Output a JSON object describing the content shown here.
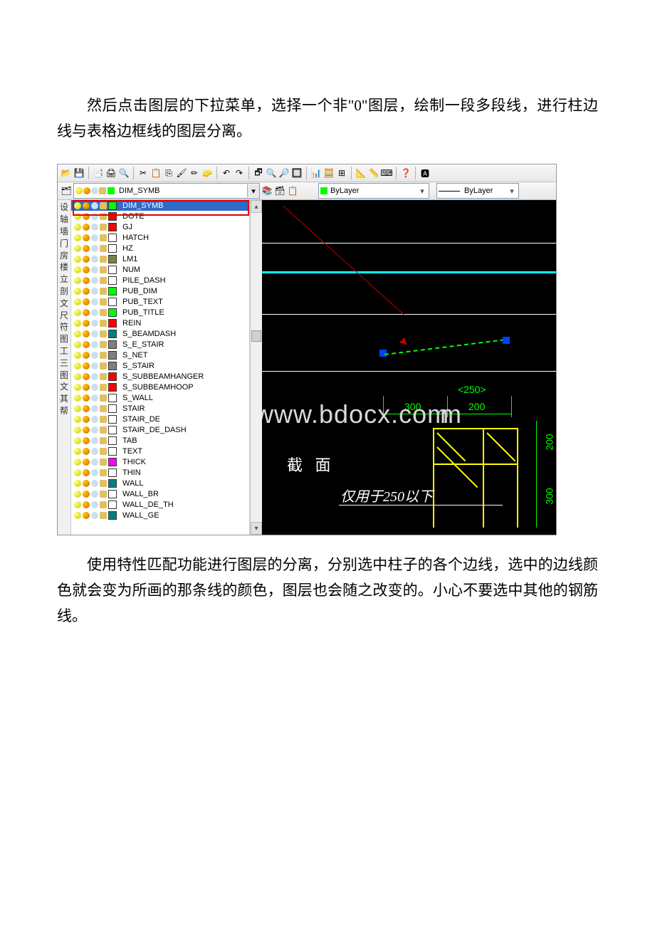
{
  "text": {
    "para1": "然后点击图层的下拉菜单，选择一个非\"0\"图层，绘制一段多段线，进行柱边线与表格边框线的图层分离。",
    "para2": "使用特性匹配功能进行图层的分离，分别选中柱子的各个边线，选中的边线颜色就会变为所画的那条线的颜色，图层也会随之改变的。小心不要选中其他的钢筋线。"
  },
  "toolbar": {
    "glyphs": [
      "📂",
      "💾",
      "",
      "📑",
      "🖨",
      "🔍",
      "",
      "✂",
      "📋",
      "⎘",
      "🖌",
      "✏",
      "🧽",
      "",
      "↶",
      "↷",
      "",
      "🗗",
      "🔍",
      "🔎",
      "🔲",
      "",
      "📊",
      "🧮",
      "⊞",
      "",
      "📐",
      "📏",
      "⌨",
      "",
      "❓",
      "",
      "🅰"
    ]
  },
  "layerbar": {
    "current_layer": "DIM_SYMB",
    "color_combo": "ByLayer",
    "linetype_combo": "ByLayer",
    "extra_icons": [
      "layers-1",
      "layers-2",
      "layers-3"
    ]
  },
  "side_chars": [
    "设",
    "轴",
    "墙",
    "门",
    "房",
    "楼",
    "立",
    "剖",
    "文",
    "尺",
    "符",
    "图",
    "工",
    "三",
    "图",
    "文",
    "其",
    "帮"
  ],
  "layers": [
    {
      "name": "DIM_SYMB",
      "color": "#00ff00",
      "sel": true
    },
    {
      "name": "DOTE",
      "color": "#ff0000"
    },
    {
      "name": "GJ",
      "color": "#ff0000"
    },
    {
      "name": "HATCH",
      "color": "#ffffff"
    },
    {
      "name": "HZ",
      "color": "#ffffff"
    },
    {
      "name": "LM1",
      "color": "#808040"
    },
    {
      "name": "NUM",
      "color": "#ffffff"
    },
    {
      "name": "PILE_DASH",
      "color": "#ffffff"
    },
    {
      "name": "PUB_DIM",
      "color": "#00ff00"
    },
    {
      "name": "PUB_TEXT",
      "color": "#ffffff"
    },
    {
      "name": "PUB_TITLE",
      "color": "#00ff00"
    },
    {
      "name": "REIN",
      "color": "#ff0000"
    },
    {
      "name": "S_BEAMDASH",
      "color": "#008080"
    },
    {
      "name": "S_E_STAIR",
      "color": "#808080"
    },
    {
      "name": "S_NET",
      "color": "#808080"
    },
    {
      "name": "S_STAIR",
      "color": "#808080"
    },
    {
      "name": "S_SUBBEAMHANGER",
      "color": "#ff0000"
    },
    {
      "name": "S_SUBBEAMHOOP",
      "color": "#ff0000"
    },
    {
      "name": "S_WALL",
      "color": "#ffffff"
    },
    {
      "name": "STAIR",
      "color": "#ffffff"
    },
    {
      "name": "STAIR_DE",
      "color": "#ffffff"
    },
    {
      "name": "STAIR_DE_DASH",
      "color": "#ffffff"
    },
    {
      "name": "TAB",
      "color": "#ffffff"
    },
    {
      "name": "TEXT",
      "color": "#ffffff"
    },
    {
      "name": "THICK",
      "color": "#ff00ff"
    },
    {
      "name": "THIN",
      "color": "#ffffff"
    },
    {
      "name": "WALL",
      "color": "#008080"
    },
    {
      "name": "WALL_BR",
      "color": "#ffffff"
    },
    {
      "name": "WALL_DE_TH",
      "color": "#ffffff"
    },
    {
      "name": "WALL_GE",
      "color": "#008080"
    }
  ],
  "canvas": {
    "dim_bracket": "<250>",
    "dim_300": "300",
    "dim_200": "200",
    "dim_v200": "200",
    "dim_v300": "300",
    "label_section": "截 面",
    "label_note": "仅用于250以下",
    "watermark": "www.bdocx.com"
  }
}
